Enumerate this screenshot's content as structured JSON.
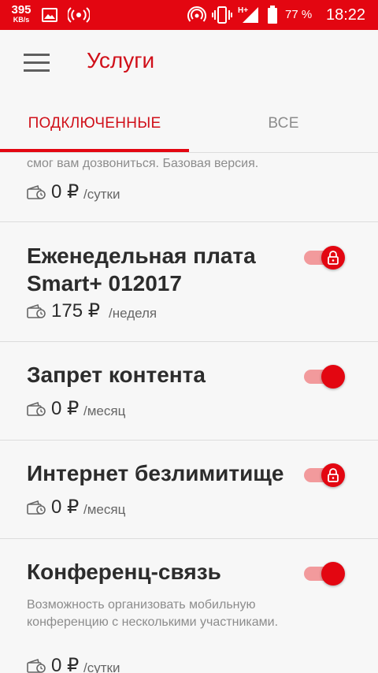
{
  "status_bar": {
    "speed_value": "395",
    "speed_unit": "KB/s",
    "battery": "77 %",
    "time": "18:22",
    "icons": [
      "image-icon",
      "broadcast-icon",
      "hotspot-icon",
      "vibrate-icon",
      "signal-h-plus-icon",
      "battery-icon"
    ]
  },
  "app_bar": {
    "title": "Услуги",
    "menu_icon": "hamburger-menu-icon"
  },
  "tabs": [
    {
      "label": "ПОДКЛЮЧЕННЫЕ",
      "active": true
    },
    {
      "label": "ВСЕ",
      "active": false
    }
  ],
  "colors": {
    "brand": "#e30611",
    "title_red": "#d0101a",
    "toggle_track": "#f29a9c"
  },
  "services": [
    {
      "title": "",
      "description": "смог вам дозвониться. Базовая версия.",
      "price": "0 ₽",
      "period": "/сутки",
      "enabled": true,
      "locked": false,
      "partially_visible": true
    },
    {
      "title": "Еженедельная плата Smart+ 012017",
      "price": "175 ₽",
      "period": "/неделя",
      "enabled": true,
      "locked": true
    },
    {
      "title": "Запрет контента",
      "price": "0 ₽",
      "period": "/месяц",
      "enabled": true,
      "locked": false
    },
    {
      "title": "Интернет безлимитище",
      "price": "0 ₽",
      "period": "/месяц",
      "enabled": true,
      "locked": true
    },
    {
      "title": "Конференц-связь",
      "description": "Возможность организовать мобильную конференцию с несколькими участниками.",
      "price": "0 ₽",
      "period": "/сутки",
      "enabled": true,
      "locked": false
    }
  ]
}
